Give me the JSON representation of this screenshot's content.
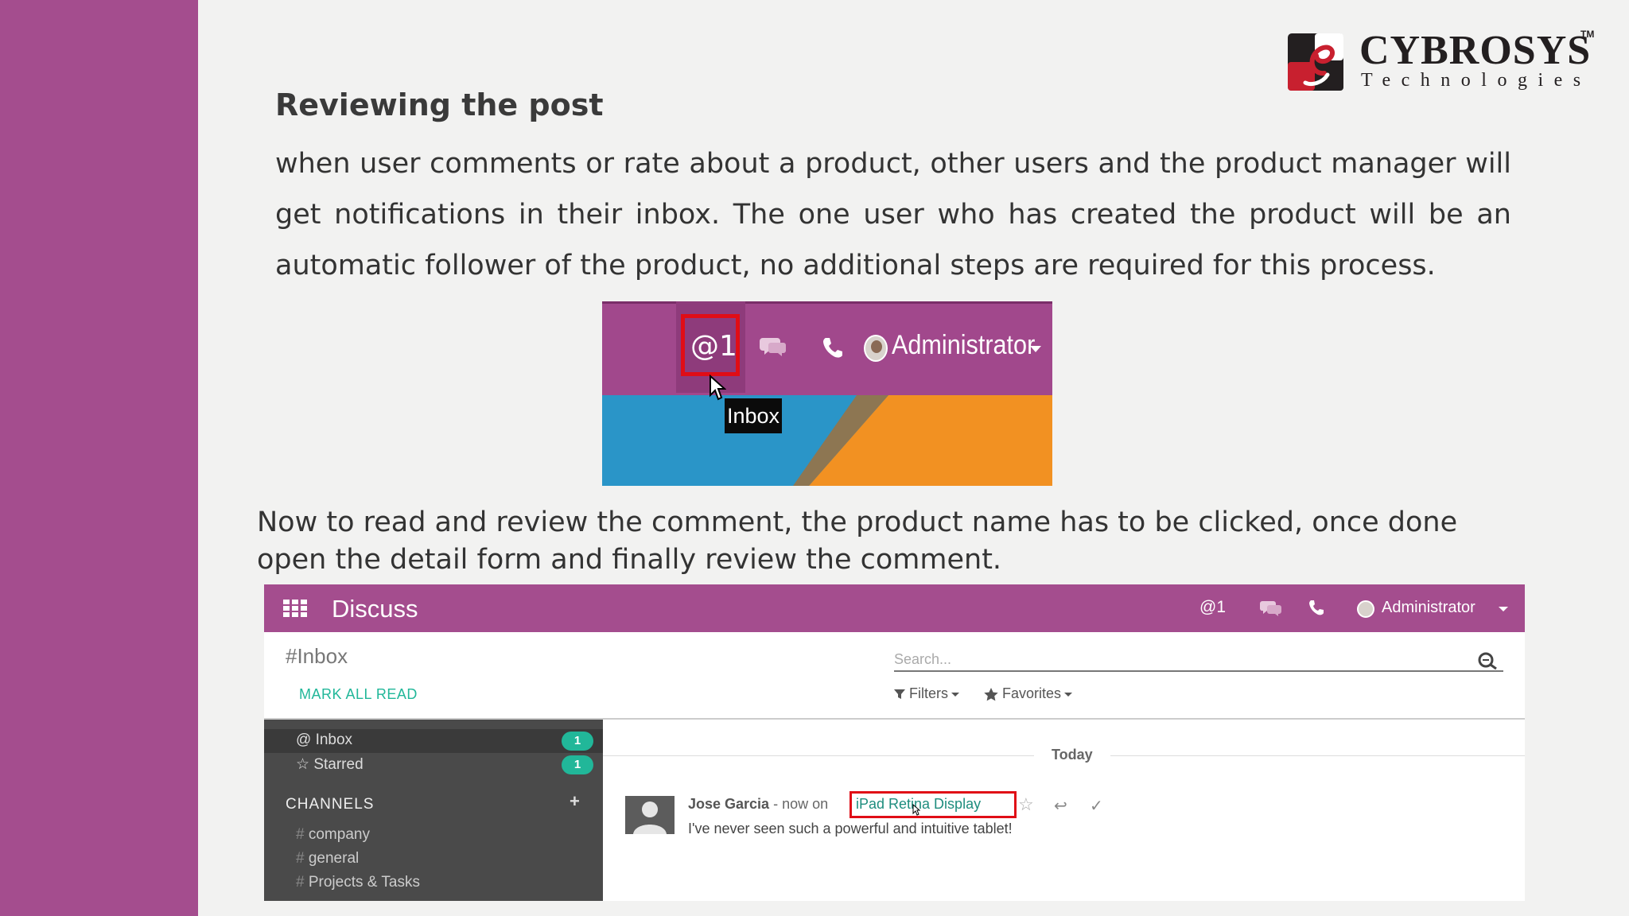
{
  "logo": {
    "name": "CYBROSYS",
    "trademark": "TM",
    "tagline": "Technologies",
    "colors": {
      "dark": "#231f20",
      "red": "#c8202f"
    }
  },
  "slide": {
    "title": "Reviewing the post",
    "paragraph_1": "when user comments or rate about a product, other users and the product manager will get notifications in their inbox. The one user who has created the product will be an automatic follower of the product, no additional steps are required for this process.",
    "paragraph_2": "Now to read and review the comment, the product name has to be clicked, once done open the detail form and finally review the comment.",
    "colors": {
      "accent_band": "#a44d8e",
      "background": "#f2f2f1"
    }
  },
  "screenshot_1": {
    "inbox_icon_text": "@1",
    "user_name": "Administrator",
    "tooltip": "Inbox",
    "icons": [
      "chat-icon",
      "phone-icon",
      "avatar-icon",
      "caret-down-icon",
      "cursor-icon"
    ],
    "colors": {
      "bar": "#a1488c",
      "highlight_box": "#e00d16",
      "bg_blue": "#2a95c8",
      "bg_orange": "#f29122"
    }
  },
  "screenshot_2": {
    "app_name": "Discuss",
    "navbar": {
      "inbox_counter": "@1",
      "user_name": "Administrator"
    },
    "channel_title": "#Inbox",
    "mark_all_read": "MARK ALL READ",
    "search": {
      "placeholder": "Search..."
    },
    "filters_label": "Filters",
    "favorites_label": "Favorites",
    "sidebar": {
      "items": [
        {
          "icon": "at-icon",
          "label": "Inbox",
          "badge": "1"
        },
        {
          "icon": "star-icon",
          "label": "Starred",
          "badge": "1"
        }
      ],
      "channels_header": "CHANNELS",
      "channels": [
        "company",
        "general",
        "Projects & Tasks"
      ]
    },
    "date_separator": "Today",
    "message": {
      "author": "Jose Garcia",
      "meta": "- now on",
      "record_link": "iPad Retina Display",
      "body": "I've never seen such a powerful and intuitive tablet!"
    },
    "colors": {
      "navbar": "#a44d8e",
      "badge": "#21b799",
      "link": "#1e8d7e",
      "sidebar": "#4a4a4a",
      "highlight_box": "#e00d16"
    }
  }
}
